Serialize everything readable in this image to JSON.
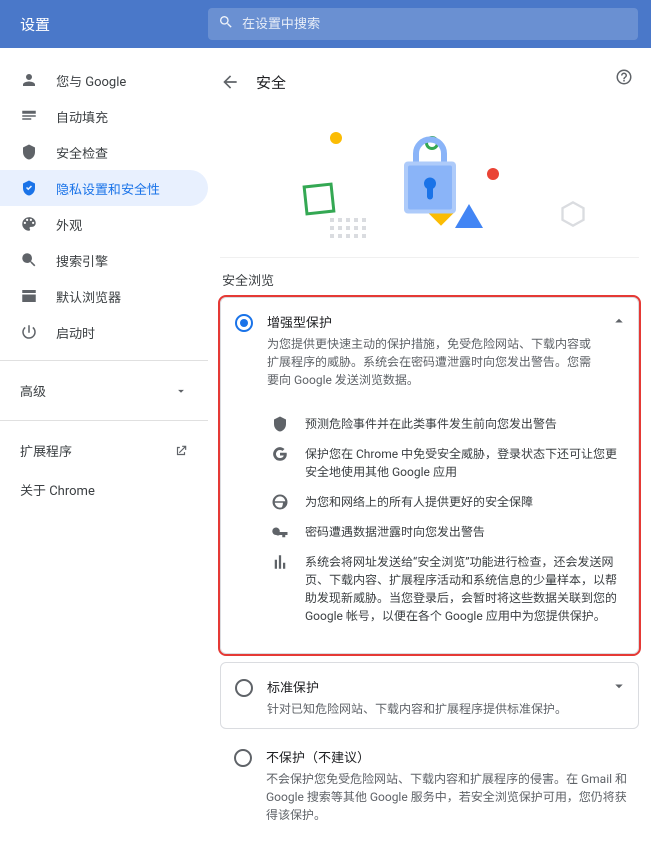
{
  "topbar": {
    "title": "设置",
    "search_placeholder": "在设置中搜索"
  },
  "sidebar": {
    "items": [
      {
        "label": "您与 Google"
      },
      {
        "label": "自动填充"
      },
      {
        "label": "安全检查"
      },
      {
        "label": "隐私设置和安全性"
      },
      {
        "label": "外观"
      },
      {
        "label": "搜索引擎"
      },
      {
        "label": "默认浏览器"
      },
      {
        "label": "启动时"
      }
    ],
    "advanced": "高级",
    "extensions": "扩展程序",
    "about": "关于 Chrome"
  },
  "header": {
    "title": "安全"
  },
  "section": "安全浏览",
  "options": {
    "enhanced": {
      "title": "增强型保护",
      "desc": "为您提供更快速主动的保护措施，免受危险网站、下载内容或扩展程序的威胁。系统会在密码遭泄露时向您发出警告。您需要向 Google 发送浏览数据。",
      "features": [
        "预测危险事件并在此类事件发生前向您发出警告",
        "保护您在 Chrome 中免受安全威胁，登录状态下还可让您更安全地使用其他 Google 应用",
        "为您和网络上的所有人提供更好的安全保障",
        "密码遭遇数据泄露时向您发出警告",
        "系统会将网址发送给“安全浏览”功能进行检查，还会发送网页、下载内容、扩展程序活动和系统信息的少量样本，以帮助发现新威胁。当您登录后，会暂时将这些数据关联到您的 Google 帐号，以便在各个 Google 应用中为您提供保护。"
      ]
    },
    "standard": {
      "title": "标准保护",
      "desc": "针对已知危险网站、下载内容和扩展程序提供标准保护。"
    },
    "none": {
      "title": "不保护（不建议）",
      "desc": "不会保护您免受危险网站、下载内容和扩展程序的侵害。在 Gmail 和 Google 搜索等其他 Google 服务中，若安全浏览保护可用，您仍将获得该保护。"
    }
  }
}
